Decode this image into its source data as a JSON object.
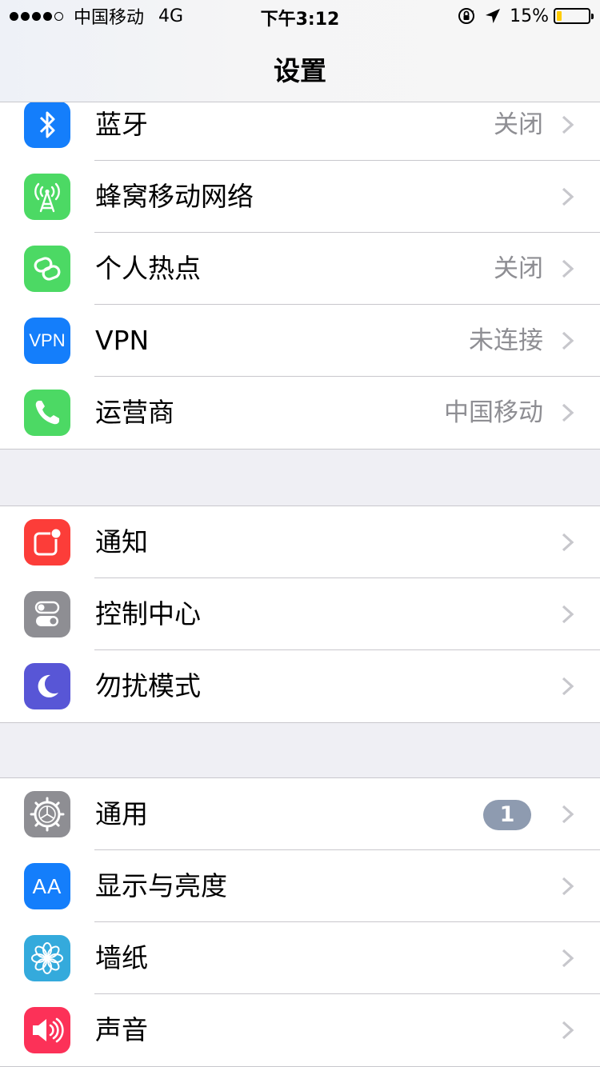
{
  "status_bar": {
    "carrier": "中国移动",
    "network": "4G",
    "time": "下午3:12",
    "battery_percent": "15%",
    "battery_level": 0.15,
    "signal_bars_filled": 4,
    "signal_bars_total": 5,
    "icons": [
      "orientation-lock-icon",
      "location-arrow-icon",
      "battery-icon"
    ]
  },
  "nav": {
    "title": "设置"
  },
  "groups": [
    {
      "rows": [
        {
          "label": "蓝牙",
          "value": "关闭",
          "icon": "bluetooth-icon",
          "color": "#147efb"
        },
        {
          "label": "蜂窝移动网络",
          "value": "",
          "icon": "cellular-antenna-icon",
          "color": "#4cd964"
        },
        {
          "label": "个人热点",
          "value": "关闭",
          "icon": "hotspot-chain-icon",
          "color": "#4cd964"
        },
        {
          "label": "VPN",
          "value": "未连接",
          "icon": "vpn-icon",
          "icon_text": "VPN",
          "color": "#147efb"
        },
        {
          "label": "运营商",
          "value": "中国移动",
          "icon": "phone-icon",
          "color": "#4cd964"
        }
      ]
    },
    {
      "rows": [
        {
          "label": "通知",
          "icon": "notifications-icon",
          "color": "#fc3d39"
        },
        {
          "label": "控制中心",
          "icon": "control-center-toggles-icon",
          "color": "#8e8e93"
        },
        {
          "label": "勿扰模式",
          "icon": "moon-icon",
          "color": "#5856d6"
        }
      ]
    },
    {
      "rows": [
        {
          "label": "通用",
          "badge": "1",
          "icon": "gear-icon",
          "color": "#8e8e93"
        },
        {
          "label": "显示与亮度",
          "icon": "text-size-aa-icon",
          "icon_text": "AA",
          "color": "#147efb"
        },
        {
          "label": "墙纸",
          "icon": "wallpaper-flower-icon",
          "color": "#34aadc"
        },
        {
          "label": "声音",
          "icon": "speaker-icon",
          "color": "#fc3158"
        }
      ]
    }
  ]
}
